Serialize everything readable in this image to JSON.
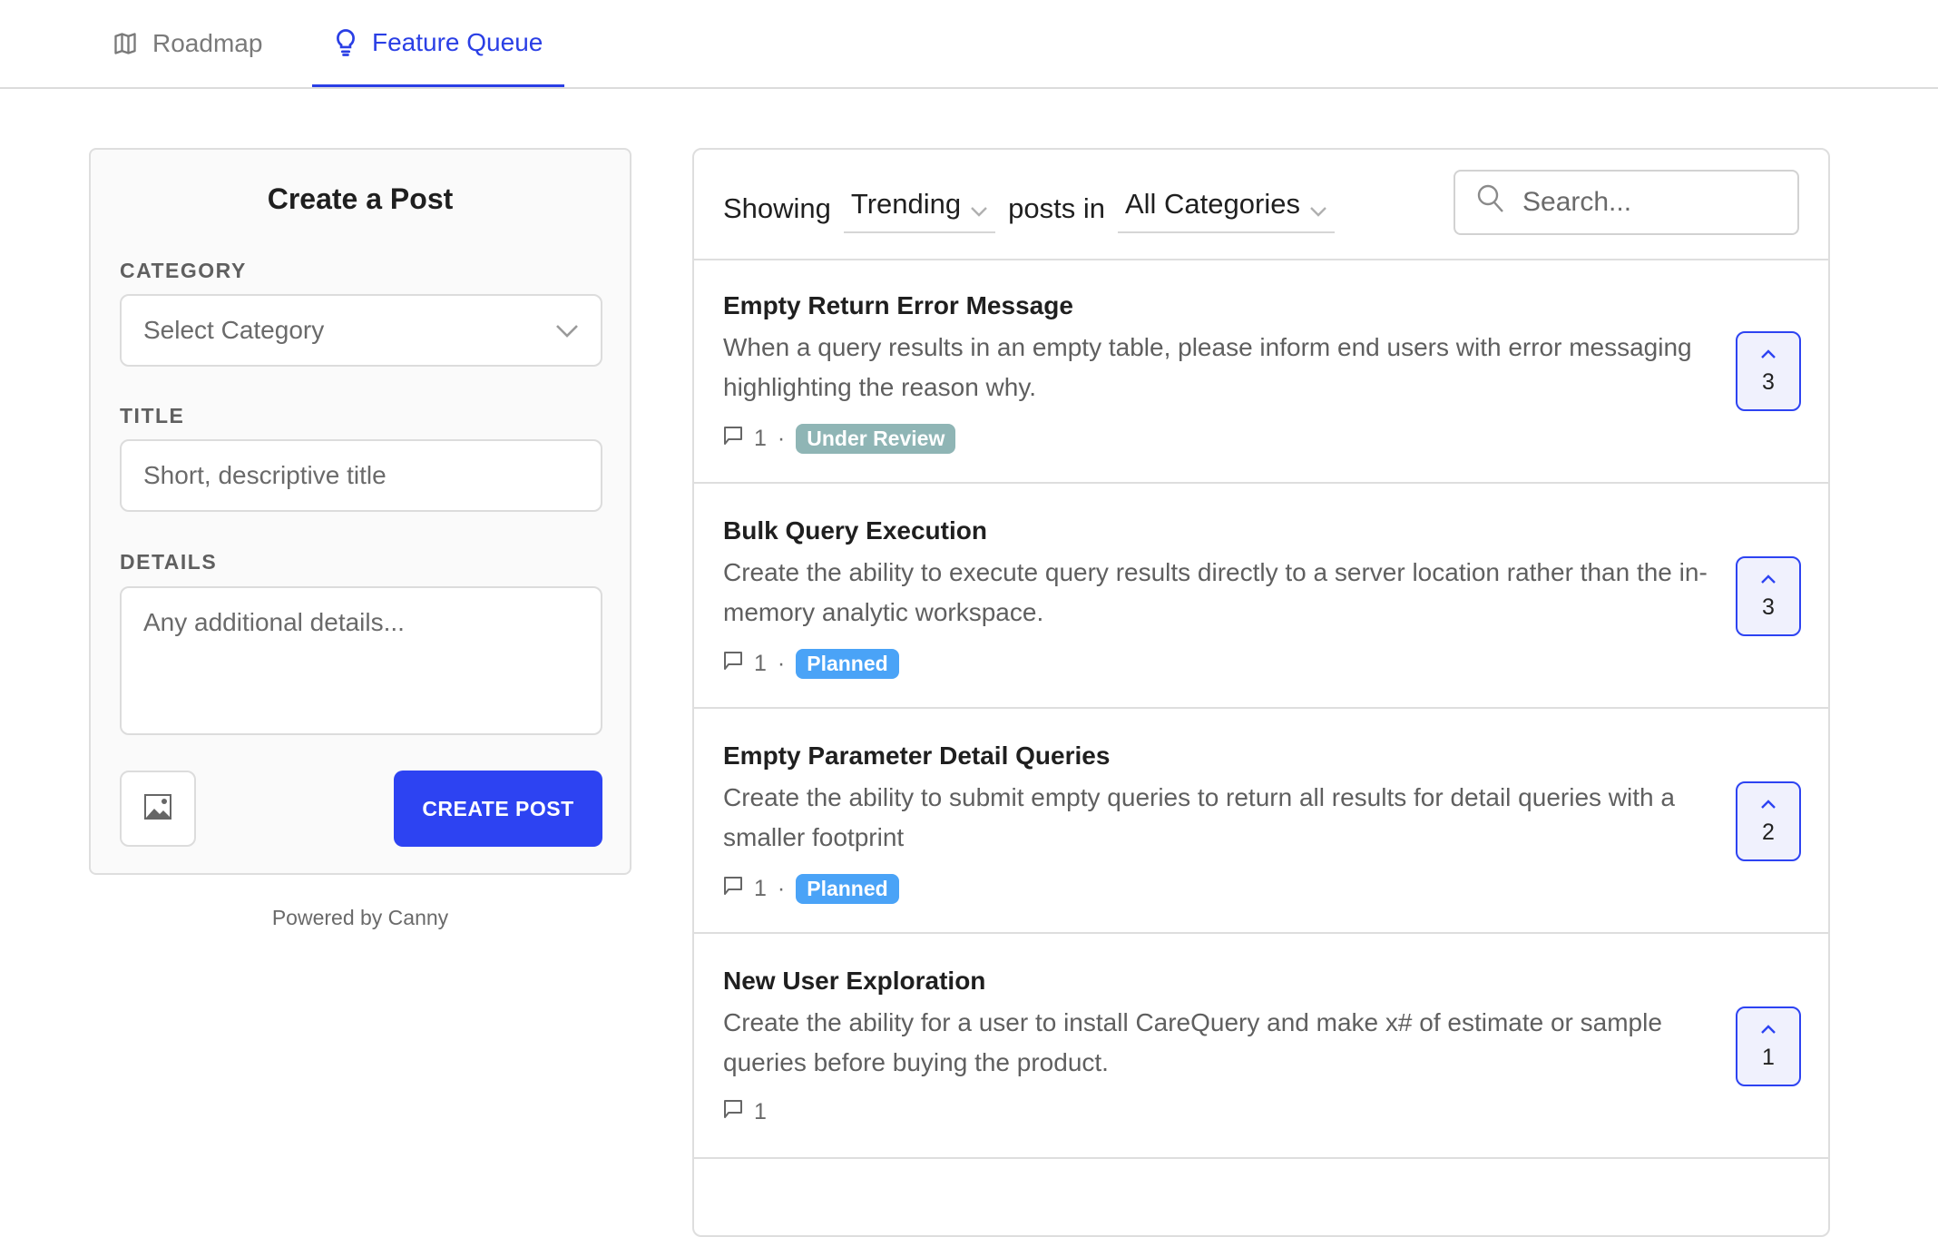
{
  "tabs": [
    {
      "label": "Roadmap",
      "icon": "map-icon",
      "active": false
    },
    {
      "label": "Feature Queue",
      "icon": "lightbulb-icon",
      "active": true
    }
  ],
  "create_post": {
    "title": "Create a Post",
    "category_label": "CATEGORY",
    "category_value": "Select Category",
    "title_label": "TITLE",
    "title_placeholder": "Short, descriptive title",
    "details_label": "DETAILS",
    "details_placeholder": "Any additional details...",
    "image_button_icon": "image-icon",
    "submit_label": "CREATE POST"
  },
  "powered_by": "Powered by Canny",
  "filter": {
    "showing_label": "Showing",
    "sort_value": "Trending",
    "posts_in_label": "posts in",
    "category_value": "All Categories",
    "search_placeholder": "Search..."
  },
  "colors": {
    "accent": "#2d43f2",
    "under_review": "#8fb5b5",
    "planned": "#4aa3f7"
  },
  "posts": [
    {
      "title": "Empty Return Error Message",
      "description": "When a query results in an empty table, please inform end users with error messaging highlighting the reason why.",
      "comments": "1",
      "separator": "·",
      "status": "Under Review",
      "status_color": "#8fb5b5",
      "votes": "3"
    },
    {
      "title": "Bulk Query Execution",
      "description": "Create the ability to execute query results directly to a server location rather than the in-memory analytic workspace.",
      "comments": "1",
      "separator": "·",
      "status": "Planned",
      "status_color": "#4aa3f7",
      "votes": "3"
    },
    {
      "title": "Empty Parameter Detail Queries",
      "description": "Create the ability to submit empty queries to return all results for detail queries with a smaller footprint",
      "comments": "1",
      "separator": "·",
      "status": "Planned",
      "status_color": "#4aa3f7",
      "votes": "2"
    },
    {
      "title": "New User Exploration",
      "description": "Create the ability for a user to install CareQuery and make x# of estimate or sample queries before buying the product.",
      "comments": "1",
      "separator": "",
      "status": "",
      "status_color": "",
      "votes": "1"
    }
  ]
}
